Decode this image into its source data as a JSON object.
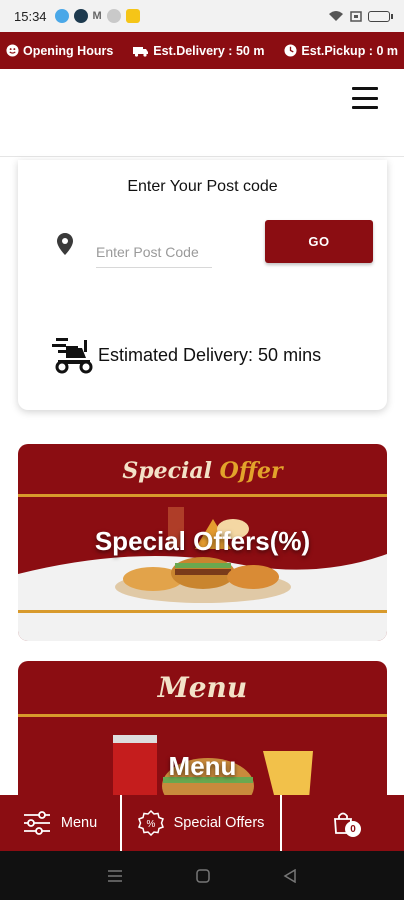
{
  "status_bar": {
    "time": "15:34",
    "icons": [
      "app-icon-1",
      "app-icon-2",
      "gmail-icon",
      "app-icon-4",
      "app-icon-5"
    ],
    "right_icons": [
      "wifi-icon",
      "sim-icon",
      "battery-icon"
    ]
  },
  "info_bar": {
    "opening_hours": "Opening Hours",
    "est_delivery": "Est.Delivery : 50 m",
    "est_pickup": "Est.Pickup : 0 m"
  },
  "postcode_card": {
    "title": "Enter Your Post code",
    "input_placeholder": "Enter Post Code",
    "go_label": "GO",
    "estimated_delivery": "Estimated Delivery: 50 mins"
  },
  "banners": {
    "special": {
      "script_part1": "Special",
      "script_part2": "Offer",
      "overlay": "Special Offers(%)"
    },
    "menu": {
      "script": "Menu",
      "overlay": "Menu"
    }
  },
  "bottom_nav": {
    "menu_label": "Menu",
    "offers_label": "Special Offers",
    "cart_count": "0"
  },
  "colors": {
    "brand": "#8b0d12",
    "gold": "#d89a2c"
  }
}
